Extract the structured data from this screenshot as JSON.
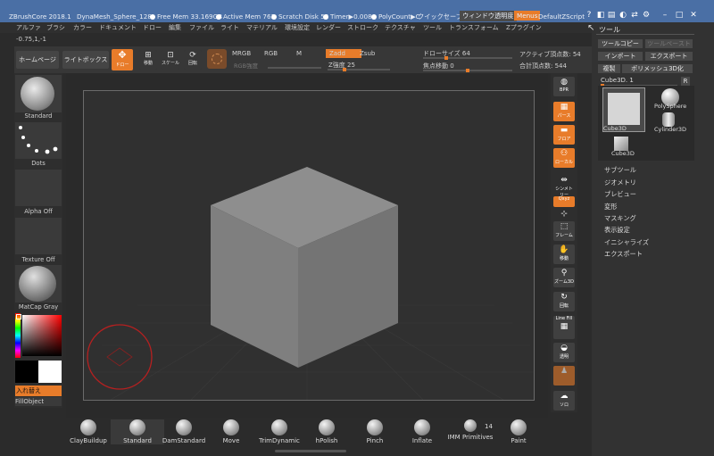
{
  "titlebar": {
    "app": "ZBrushCore 2018.1",
    "document": "DynaMesh_Sphere_128",
    "free_mem": "Free Mem 33.169GB",
    "active_mem": "Active Mem 762",
    "scratch_disk": "Scratch Disk 52",
    "timer": "Timer▶0.008",
    "polycount": "PolyCount▶C",
    "quicksave": "クイックセーブ",
    "window_transparency": "ウィンドウ透明度",
    "menus": "Menus",
    "zscript": "DefaultZScript"
  },
  "menubar": [
    "アルファ",
    "ブラシ",
    "カラー",
    "ドキュメント",
    "ドロー",
    "編集",
    "ファイル",
    "ライト",
    "マテリアル",
    "環境設定",
    "レンダー",
    "ストローク",
    "テクスチャ",
    "ツール",
    "トランスフォーム",
    "Zプラグイン"
  ],
  "coords": "-0.75,1,-1",
  "shelf": {
    "home": "ホームページ",
    "lightbox": "ライトボックス",
    "draw": "ドロー",
    "move": "移動",
    "scale": "スケール",
    "rotate": "回転",
    "mrgb": "MRGB",
    "rgb": "RGB",
    "m": "M",
    "rgb_intensity": "RGB強度",
    "zadd": "Zadd",
    "zsub": "Zsub",
    "z_intensity": "Z強度 25",
    "draw_size": "ドローサイズ 64",
    "focal_shift": "焦点移動 0",
    "active_points": "アクティブ頂点数: 54",
    "total_points": "合計頂点数: 544",
    "draw_size_level": 0.25,
    "focal_shift_level": 0.5,
    "z_intensity_level": 0.25
  },
  "left_panel": {
    "brush": "Standard",
    "stroke": "Dots",
    "alpha": "Alpha Off",
    "texture": "Texture Off",
    "material": "MatCap Gray",
    "swap": "入れ替え",
    "fill": "FillObject"
  },
  "right_bar": [
    {
      "icon": "bpr-icon",
      "label": "BPR"
    },
    {
      "icon": "perspective-icon",
      "label": "パース"
    },
    {
      "icon": "floor-icon",
      "label": "フロア"
    },
    {
      "icon": "local-icon",
      "label": "ローカル"
    },
    {
      "icon": "symmetry-icon",
      "label": "シンメトリー"
    },
    {
      "icon": "xyz-icon",
      "label": "Qxyz"
    },
    {
      "icon": "frame-icon",
      "label": "フレーム"
    },
    {
      "icon": "move-view-icon",
      "label": "移動"
    },
    {
      "icon": "zoom3d-icon",
      "label": "ズーム3D"
    },
    {
      "icon": "rotate-view-icon",
      "label": "回転"
    },
    {
      "icon": "linefill-icon",
      "label": "Line Fill"
    },
    {
      "icon": "transparent-icon",
      "label": "透明"
    },
    {
      "icon": "solo-icon",
      "label": "ソロ"
    }
  ],
  "tool_panel": {
    "title": "ツール",
    "copy": "ツールコピー",
    "paste": "ツールペースト",
    "import": "インポート",
    "export": "エクスポート",
    "clone": "複製",
    "polymesh": "ポリメッシュ3D化",
    "current": "Cube3D. 1",
    "r_button": "R",
    "tools": [
      "Cube3D",
      "PolySphere",
      "Cylinder3D",
      "Cube3D"
    ],
    "sections": [
      "サブツール",
      "ジオメトリ",
      "プレビュー",
      "変形",
      "マスキング",
      "表示設定",
      "イニシャライズ",
      "エクスポート"
    ]
  },
  "bottom_brushes": [
    "ClayBuildup",
    "Standard",
    "DamStandard",
    "Move",
    "TrimDynamic",
    "hPolish",
    "Pinch",
    "Inflate",
    "IMM Primitives",
    "Paint"
  ],
  "imm_count": "14",
  "colors": {
    "accent": "#e87c2a",
    "titlebar": "#4a6fa5",
    "panel": "#323232"
  }
}
